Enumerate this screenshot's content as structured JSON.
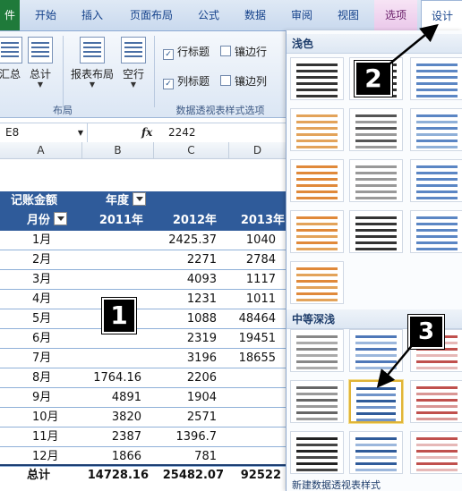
{
  "ribbon": {
    "tabs": [
      {
        "label": "件"
      },
      {
        "label": "开始"
      },
      {
        "label": "插入"
      },
      {
        "label": "页面布局"
      },
      {
        "label": "公式"
      },
      {
        "label": "数据"
      },
      {
        "label": "审阅"
      },
      {
        "label": "视图"
      },
      {
        "label": "选项"
      },
      {
        "label": "设计"
      }
    ],
    "buttons": {
      "subtotal": "汇总",
      "grand_total": "总计",
      "report_layout": "报表布局",
      "blank_rows": "空行"
    },
    "group_layout": "布局",
    "group_style_options": "数据透视表样式选项",
    "options": {
      "row_headers": "行标题",
      "col_headers": "列标题",
      "banded_rows": "镶边行",
      "banded_cols": "镶边列"
    }
  },
  "formula_bar": {
    "name_box": "E8",
    "fx": "fx",
    "value": "2242"
  },
  "sheet": {
    "columns": [
      "A",
      "B",
      "C",
      "D"
    ],
    "pivot_header": {
      "field": "记账金额",
      "column_field": "年度",
      "row_field": "月份",
      "years": [
        "2011年",
        "2012年",
        "2013年"
      ]
    },
    "rows": [
      {
        "month": "1月",
        "y2011": "",
        "y2012": "2425.37",
        "y2013": "1040"
      },
      {
        "month": "2月",
        "y2011": "",
        "y2012": "2271",
        "y2013": "2784"
      },
      {
        "month": "3月",
        "y2011": "",
        "y2012": "4093",
        "y2013": "1117"
      },
      {
        "month": "4月",
        "y2011": "",
        "y2012": "1231",
        "y2013": "1011"
      },
      {
        "month": "5月",
        "y2011": "",
        "y2012": "1088",
        "y2013": "48464"
      },
      {
        "month": "6月",
        "y2011": "",
        "y2012": "2319",
        "y2013": "19451"
      },
      {
        "month": "7月",
        "y2011": "",
        "y2012": "3196",
        "y2013": "18655"
      },
      {
        "month": "8月",
        "y2011": "1764.16",
        "y2012": "2206",
        "y2013": ""
      },
      {
        "month": "9月",
        "y2011": "4891",
        "y2012": "1904",
        "y2013": ""
      },
      {
        "month": "10月",
        "y2011": "3820",
        "y2012": "2571",
        "y2013": ""
      },
      {
        "month": "11月",
        "y2011": "2387",
        "y2012": "1396.7",
        "y2013": ""
      },
      {
        "month": "12月",
        "y2011": "1866",
        "y2012": "781",
        "y2013": ""
      }
    ],
    "total": {
      "label": "总计",
      "y2011": "14728.16",
      "y2012": "25482.07",
      "y2013": "92522"
    }
  },
  "gallery": {
    "light_label": "浅色",
    "medium_label": "中等深浅",
    "bottom_text": "新建数据透视表样式"
  },
  "callouts": [
    "1",
    "2",
    "3"
  ]
}
